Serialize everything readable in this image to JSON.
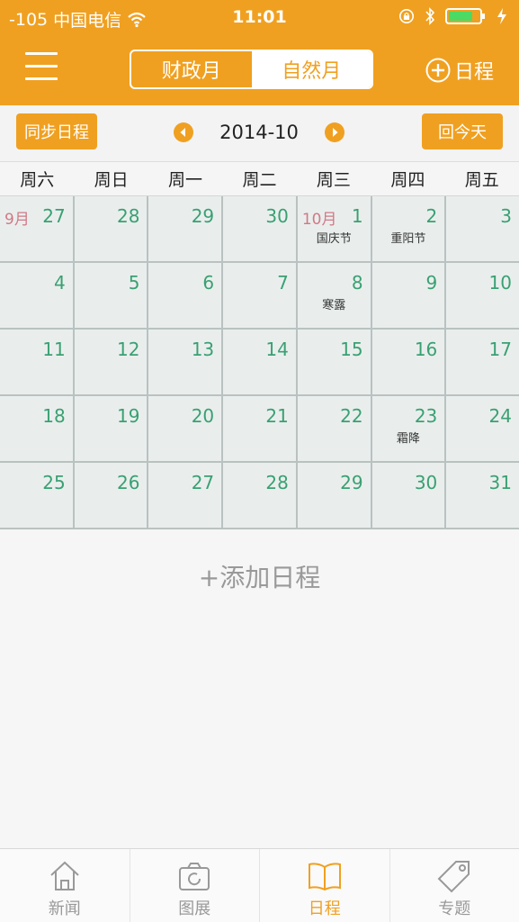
{
  "status_bar": {
    "signal": "-105",
    "carrier": "中国电信",
    "time": "11:01"
  },
  "nav": {
    "segments": [
      {
        "label": "财政月",
        "active": false
      },
      {
        "label": "自然月",
        "active": true
      }
    ],
    "add_label": "日程"
  },
  "toolbar": {
    "sync_label": "同步日程",
    "month": "2014-10",
    "today_label": "回今天"
  },
  "weekdays": [
    "周六",
    "周日",
    "周一",
    "周二",
    "周三",
    "周四",
    "周五"
  ],
  "calendar": {
    "weeks": [
      [
        {
          "day": "27",
          "month_mark": "9月",
          "label": ""
        },
        {
          "day": "28",
          "month_mark": "",
          "label": ""
        },
        {
          "day": "29",
          "month_mark": "",
          "label": ""
        },
        {
          "day": "30",
          "month_mark": "",
          "label": ""
        },
        {
          "day": "1",
          "month_mark": "10月",
          "label": "国庆节"
        },
        {
          "day": "2",
          "month_mark": "",
          "label": "重阳节"
        },
        {
          "day": "3",
          "month_mark": "",
          "label": ""
        }
      ],
      [
        {
          "day": "4",
          "month_mark": "",
          "label": ""
        },
        {
          "day": "5",
          "month_mark": "",
          "label": ""
        },
        {
          "day": "6",
          "month_mark": "",
          "label": ""
        },
        {
          "day": "7",
          "month_mark": "",
          "label": ""
        },
        {
          "day": "8",
          "month_mark": "",
          "label": "寒露"
        },
        {
          "day": "9",
          "month_mark": "",
          "label": ""
        },
        {
          "day": "10",
          "month_mark": "",
          "label": ""
        }
      ],
      [
        {
          "day": "11",
          "month_mark": "",
          "label": ""
        },
        {
          "day": "12",
          "month_mark": "",
          "label": ""
        },
        {
          "day": "13",
          "month_mark": "",
          "label": ""
        },
        {
          "day": "14",
          "month_mark": "",
          "label": ""
        },
        {
          "day": "15",
          "month_mark": "",
          "label": ""
        },
        {
          "day": "16",
          "month_mark": "",
          "label": ""
        },
        {
          "day": "17",
          "month_mark": "",
          "label": ""
        }
      ],
      [
        {
          "day": "18",
          "month_mark": "",
          "label": ""
        },
        {
          "day": "19",
          "month_mark": "",
          "label": ""
        },
        {
          "day": "20",
          "month_mark": "",
          "label": ""
        },
        {
          "day": "21",
          "month_mark": "",
          "label": ""
        },
        {
          "day": "22",
          "month_mark": "",
          "label": ""
        },
        {
          "day": "23",
          "month_mark": "",
          "label": "霜降"
        },
        {
          "day": "24",
          "month_mark": "",
          "label": ""
        }
      ],
      [
        {
          "day": "25",
          "month_mark": "",
          "label": ""
        },
        {
          "day": "26",
          "month_mark": "",
          "label": ""
        },
        {
          "day": "27",
          "month_mark": "",
          "label": ""
        },
        {
          "day": "28",
          "month_mark": "",
          "label": ""
        },
        {
          "day": "29",
          "month_mark": "",
          "label": ""
        },
        {
          "day": "30",
          "month_mark": "",
          "label": ""
        },
        {
          "day": "31",
          "month_mark": "",
          "label": ""
        }
      ]
    ]
  },
  "add_schedule_label": "+添加日程",
  "tabbar": {
    "tabs": [
      {
        "label": "新闻",
        "icon": "home-icon",
        "active": false
      },
      {
        "label": "图展",
        "icon": "camera-icon",
        "active": false
      },
      {
        "label": "日程",
        "icon": "book-icon",
        "active": true
      },
      {
        "label": "专题",
        "icon": "tag-icon",
        "active": false
      }
    ]
  },
  "colors": {
    "accent": "#f0a020",
    "day_number": "#3aa072",
    "month_mark": "#d07a86",
    "cell_bg": "#e9eeed"
  }
}
